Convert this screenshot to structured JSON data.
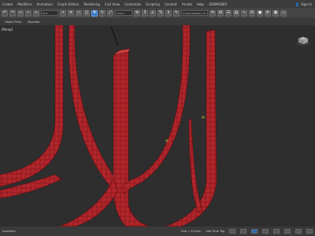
{
  "menu": [
    "Create",
    "Modifiers",
    "Animation",
    "Graph Editors",
    "Rendering",
    "Civil View",
    "Customize",
    "Scripting",
    "Content",
    "Arnold",
    "Help",
    "3DSMODEO"
  ],
  "account": {
    "sign_in": "Sign In"
  },
  "toolbar": {
    "selection_set_value": "Create Selection Se"
  },
  "ribbon": [
    "Object Paint",
    "Populate"
  ],
  "viewport": {
    "label": "[Persp]"
  },
  "status": {
    "left_text": "Academic",
    "grid_text": "Grid = 10,0cm",
    "addtime_text": "Add Time Tag"
  },
  "colors": {
    "object": "#b1262b",
    "background": "#2e2e2e",
    "accent": "#3a76c4"
  },
  "icons": [
    "undo-icon",
    "redo-icon",
    "link-icon",
    "unlink-icon",
    "bind-icon",
    "select-icon",
    "select-by-name-icon",
    "rect-region-icon",
    "window-crossing-icon",
    "move-icon",
    "rotate-icon",
    "scale-icon",
    "pivot-icon",
    "snap-icon",
    "angle-snap-icon",
    "percent-snap-icon",
    "spinner-snap-icon",
    "named-selection-icon",
    "mirror-icon",
    "align-icon",
    "layer-icon",
    "graphite-icon",
    "curve-editor-icon",
    "schematic-icon",
    "material-editor-icon",
    "render-setup-icon",
    "render-frame-icon",
    "render-icon"
  ]
}
